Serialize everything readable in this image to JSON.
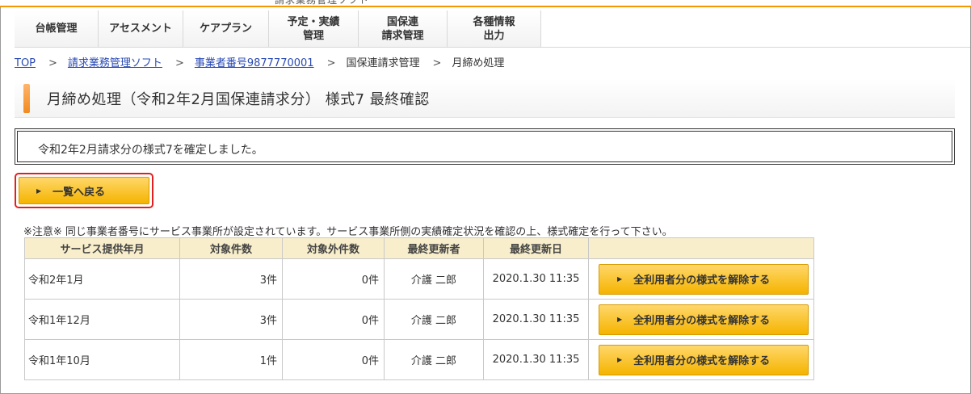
{
  "top_cut_text": "請求業務管理ソフト",
  "nav": [
    {
      "label": "台帳管理",
      "width": 104
    },
    {
      "label": "アセスメント",
      "width": 105
    },
    {
      "label": "ケアプラン",
      "width": 106
    },
    {
      "label": "予定・実績\n管理",
      "width": 111
    },
    {
      "label": "国保連\n請求管理",
      "width": 110
    },
    {
      "label": "各種情報\n出力",
      "width": 116
    }
  ],
  "breadcrumb": {
    "items": [
      "TOP",
      "請求業務管理ソフト",
      "事業者番号9877770001",
      "国保連請求管理",
      "月締め処理"
    ],
    "separator": ">"
  },
  "heading": {
    "title": "月締め処理（令和2年2月国保連請求分） 様式7 最終確認"
  },
  "message": "令和2年2月請求分の様式7を確定しました。",
  "back_button": {
    "label": "一覧へ戻る",
    "arrow": "▶"
  },
  "notice": "※注意※  同じ事業者番号にサービス事業所が設定されています。サービス事業所側の実績確定状況を確認の上、様式確定を行って下さい。",
  "table": {
    "headers": [
      "サービス提供年月",
      "対象件数",
      "対象外件数",
      "最終更新者",
      "最終更新日",
      ""
    ],
    "rows": [
      {
        "month": "令和2年1月",
        "count": "3件",
        "excluded": "0件",
        "user": "介護 二郎",
        "date": "2020.1.30 11:35",
        "action": "全利用者分の様式を解除する"
      },
      {
        "month": "令和1年12月",
        "count": "3件",
        "excluded": "0件",
        "user": "介護 二郎",
        "date": "2020.1.30 11:35",
        "action": "全利用者分の様式を解除する"
      },
      {
        "month": "令和1年10月",
        "count": "1件",
        "excluded": "0件",
        "user": "介護 二郎",
        "date": "2020.1.30 11:35",
        "action": "全利用者分の様式を解除する"
      }
    ]
  },
  "colors": {
    "accent_orange": "#f39800",
    "button_yellow": "#f5b400",
    "table_header_bg": "#f8eecb",
    "highlight_red": "#e02020",
    "link_blue": "#2a4ab3"
  }
}
